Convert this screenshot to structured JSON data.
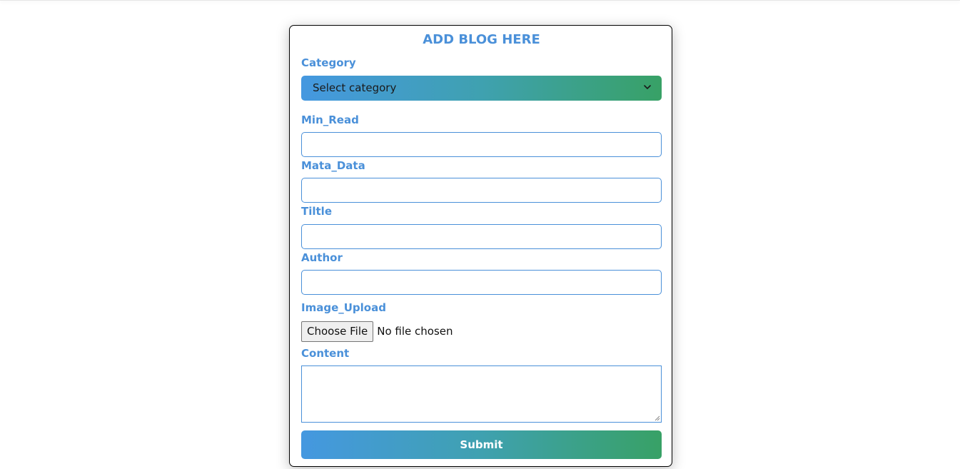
{
  "form": {
    "title": "ADD BLOG HERE",
    "category": {
      "label": "Category",
      "selected": "Select category"
    },
    "min_read": {
      "label": "Min_Read",
      "value": ""
    },
    "meta_data": {
      "label": "Mata_Data",
      "value": ""
    },
    "title_field": {
      "label": "Tiltle",
      "value": ""
    },
    "author": {
      "label": "Author",
      "value": ""
    },
    "image_upload": {
      "label": "Image_Upload",
      "button_label": "Choose File",
      "status": "No file chosen"
    },
    "content": {
      "label": "Content",
      "value": ""
    },
    "submit_label": "Submit"
  },
  "colors": {
    "accent": "#4a90d9",
    "gradient_start": "#4598e0",
    "gradient_end": "#38a166"
  },
  "icons": {
    "select_chevron": "chevron-down-icon",
    "textarea_resize": "resize-handle-icon"
  }
}
